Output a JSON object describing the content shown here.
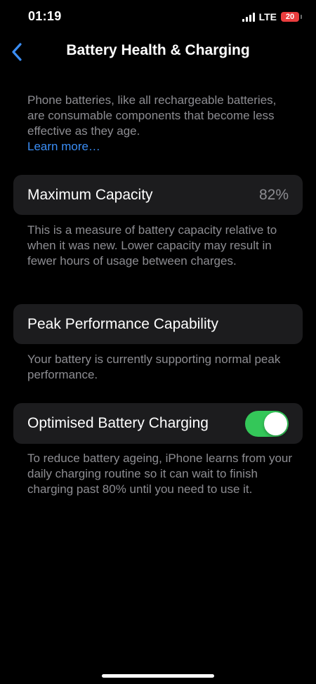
{
  "status_bar": {
    "time": "01:19",
    "network": "LTE",
    "battery_level": "20",
    "battery_color": "#ea3d3e"
  },
  "nav": {
    "back_icon": "chevron-left-icon",
    "title": "Battery Health & Charging"
  },
  "intro": {
    "text": "Phone batteries, like all rechargeable batteries, are consumable components that become less effective as they age.",
    "link": "Learn more…"
  },
  "max_capacity": {
    "label": "Maximum Capacity",
    "value": "82%",
    "footer": "This is a measure of battery capacity relative to when it was new. Lower capacity may result in fewer hours of usage between charges."
  },
  "peak_performance": {
    "label": "Peak Performance Capability",
    "footer": "Your battery is currently supporting normal peak performance."
  },
  "optimised_charging": {
    "label": "Optimised Battery Charging",
    "enabled": true,
    "footer": "To reduce battery ageing, iPhone learns from your daily charging routine so it can wait to finish charging past 80% until you need to use it."
  },
  "colors": {
    "accent": "#3b8ef5",
    "toggle_on": "#34c759",
    "cell_background": "#1c1c1e",
    "secondary_text": "#8d8d92"
  }
}
